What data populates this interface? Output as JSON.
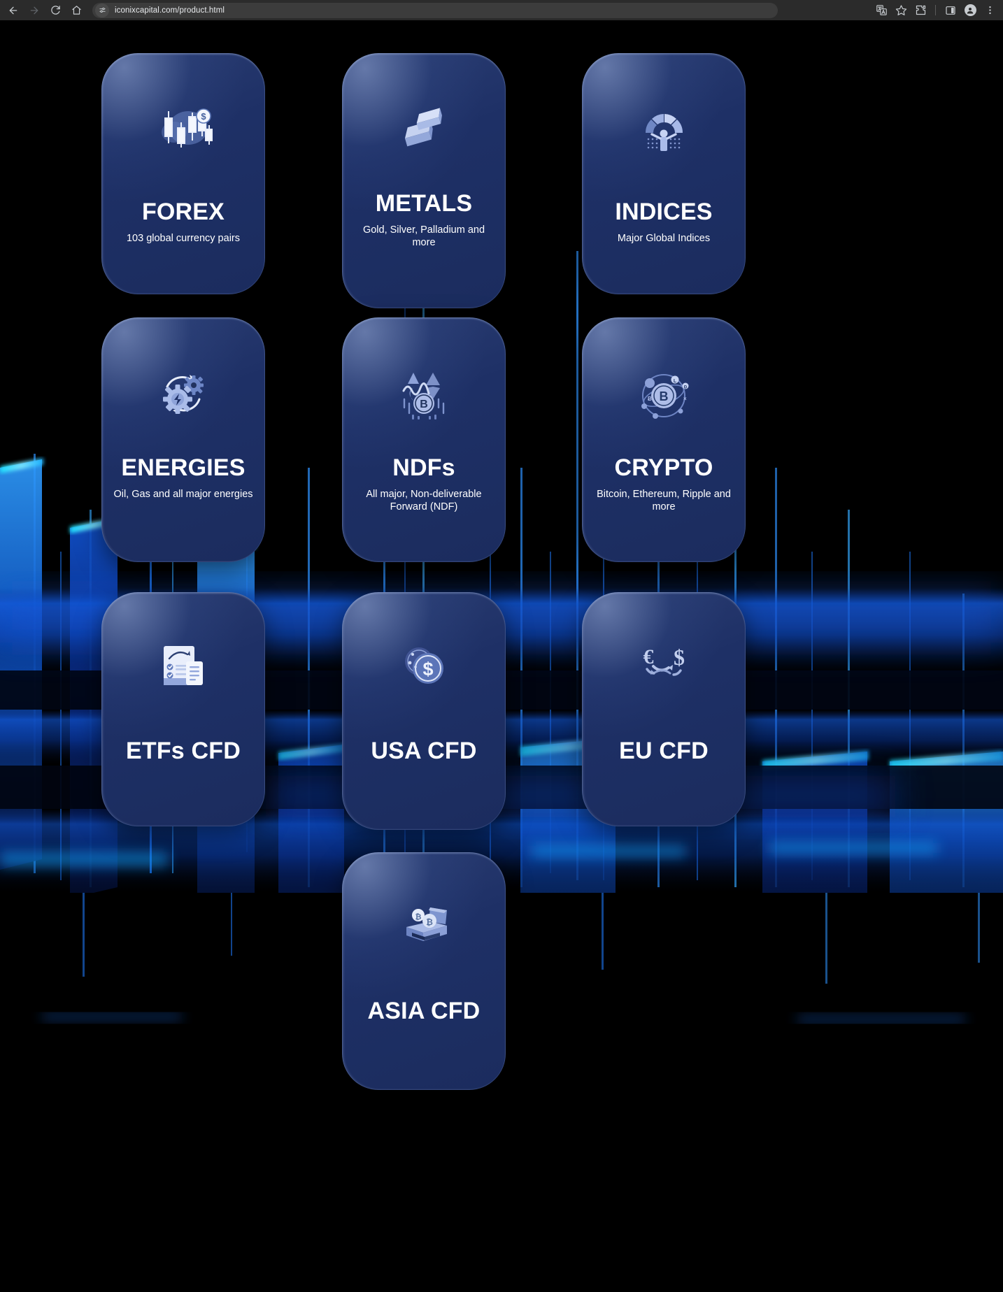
{
  "browser": {
    "back_icon": "arrow-left-icon",
    "forward_icon": "arrow-right-icon",
    "reload_icon": "reload-icon",
    "home_icon": "home-icon",
    "site_info_icon": "site-settings-icon",
    "url": "iconixcapital.com/product.html",
    "url_placeholder": "Search Google or type a URL",
    "right_icons": [
      {
        "name": "translate-icon",
        "glyph": "translate"
      },
      {
        "name": "bookmark-star-icon",
        "glyph": "star"
      },
      {
        "name": "extensions-puzzle-icon",
        "glyph": "puzzle"
      },
      {
        "name": "side-panel-icon",
        "glyph": "panel"
      },
      {
        "name": "profile-avatar-icon",
        "glyph": "person"
      },
      {
        "name": "more-menu-icon",
        "glyph": "kebab"
      }
    ]
  },
  "theme": {
    "page_background": "#000000",
    "card_fill": "#1e3066",
    "card_highlight": "#96aad7",
    "title_color": "#ffffff",
    "accent_neon": "#1f7cff",
    "icon_color": "#aebde8"
  },
  "products": [
    {
      "id": "forex",
      "icon": "candlestick-chart-dollar-icon",
      "title": "FOREX",
      "subtitle": "103 global currency pairs"
    },
    {
      "id": "metals",
      "icon": "gold-bars-icon",
      "title": "METALS",
      "subtitle": "Gold, Silver, Palladium and more"
    },
    {
      "id": "indices",
      "icon": "gauge-person-icon",
      "title": "INDICES",
      "subtitle": "Major Global Indices"
    },
    {
      "id": "energies",
      "icon": "gears-energy-icon",
      "title": "ENERGIES",
      "subtitle": "Oil, Gas and all major energies"
    },
    {
      "id": "ndfs",
      "icon": "crypto-chart-icon",
      "title": "NDFs",
      "subtitle": "All major, Non-deliverable Forward (NDF)"
    },
    {
      "id": "crypto",
      "icon": "bitcoin-orbit-icon",
      "title": "CRYPTO",
      "subtitle": "Bitcoin, Ethereum, Ripple and more"
    },
    {
      "id": "etfs",
      "icon": "checklist-document-icon",
      "title": "ETFs CFD",
      "subtitle": ""
    },
    {
      "id": "usacfd",
      "icon": "dollar-coin-icon",
      "title": "USA CFD",
      "subtitle": ""
    },
    {
      "id": "eucfd",
      "icon": "euro-dollar-exchange-icon",
      "title": "EU CFD",
      "subtitle": ""
    },
    {
      "id": "asiacfd",
      "icon": "crypto-atm-icon",
      "title": "ASIA CFD",
      "subtitle": ""
    }
  ]
}
